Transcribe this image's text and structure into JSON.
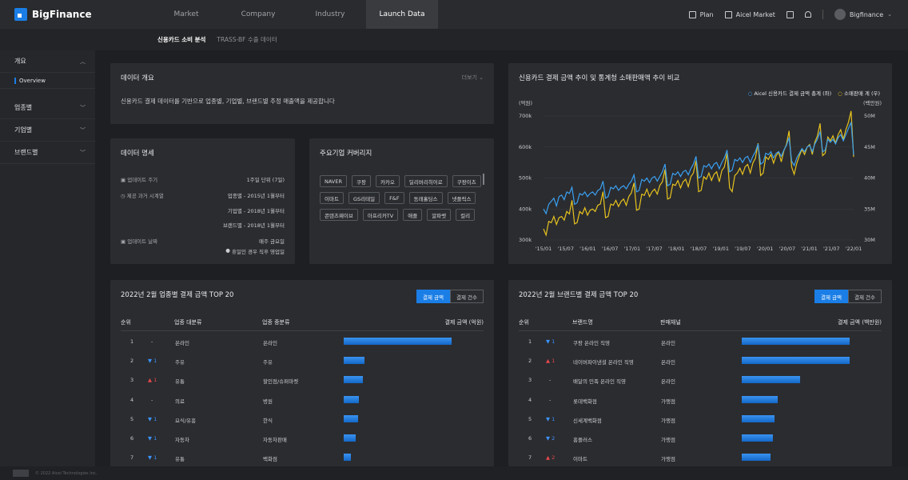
{
  "app": {
    "logo": "BigFinance"
  },
  "nav": {
    "tabs": [
      "Market",
      "Company",
      "Industry",
      "Launch Data"
    ],
    "right": {
      "plan": "Plan",
      "aicel_market": "Aicel Market",
      "user": "Bigfinance"
    }
  },
  "subnav": {
    "tabs": [
      "신용카드 소비 분석",
      "TRASS-BF 수출 데이터"
    ]
  },
  "sidebar": {
    "items": [
      {
        "label": "개요",
        "sub": "Overview"
      },
      {
        "label": "업종별"
      },
      {
        "label": "기업별"
      },
      {
        "label": "브랜드별"
      }
    ]
  },
  "overview": {
    "title": "데이터 개요",
    "more": "더보기",
    "text": "신용카드 결제 데이터를 기반으로 업종별, 기업별, 브랜드별 추정 매출액을 제공합니다"
  },
  "spec": {
    "title": "데이터 명세",
    "rows": [
      {
        "key": "업데이트 주기",
        "value": "1주일 단위 (7일)"
      },
      {
        "key": "제공 과거 시계열",
        "value": "업종별 - 2015년 1월부터"
      },
      {
        "key": "",
        "value": "기업별 - 2018년 1월부터"
      },
      {
        "key": "",
        "value": "브랜드별 - 2018년 1월부터"
      },
      {
        "key": "업데이트 날짜",
        "value": "매주 금요일"
      }
    ],
    "note": "휴일인 경우 직후 영업일"
  },
  "coverage": {
    "title": "주요기업 커버리지",
    "tags": [
      "NAVER",
      "쿠팡",
      "카카오",
      "딜리버리히어로",
      "쿠팡이츠",
      "이마트",
      "GS리테일",
      "F&F",
      "동래홀딩스",
      "넷플릭스",
      "콘텐츠웨이브",
      "아프리카TV",
      "애플",
      "알파벳",
      "컬리"
    ]
  },
  "trend": {
    "title": "신용카드 결제 금액 추이 및 통계청 소매판매액 추이 비교",
    "legend": [
      "Aicel 신용카드 결제 금액 총계 (좌)",
      "소매판매 계 (우)"
    ],
    "colors": {
      "card": "#3aa0f0",
      "retail": "#e6c21e"
    }
  },
  "chart_data": {
    "type": "line",
    "title": "신용카드 결제 금액 추이 및 통계청 소매판매액 추이 비교",
    "y_left_unit": "(억원)",
    "y_right_unit": "(백만원)",
    "y_left_ticks": [
      "700k",
      "600k",
      "500k",
      "400k",
      "300k"
    ],
    "y_right_ticks": [
      "50M",
      "45M",
      "40M",
      "35M",
      "30M"
    ],
    "x_ticks": [
      "'15/01",
      "'15/07",
      "'16/01",
      "'16/07",
      "'17/01",
      "'17/07",
      "'18/01",
      "'18/07",
      "'19/01",
      "'19/07",
      "'20/01",
      "'20/07",
      "'21/01",
      "'21/07",
      "'22/01"
    ],
    "ylim_left": [
      300000,
      700000
    ],
    "ylim_right": [
      30000000,
      50000000
    ],
    "series": [
      {
        "name": "Aicel 신용카드 결제 금액 총계 (좌)",
        "values": [
          400000,
          385000,
          415000,
          425000,
          435000,
          410000,
          440000,
          445000,
          430000,
          455000,
          450000,
          470000,
          415000,
          420000,
          450000,
          445000,
          455000,
          440000,
          450000,
          455000,
          445000,
          460000,
          465000,
          490000,
          435000,
          440000,
          470000,
          465000,
          475000,
          460000,
          470000,
          475000,
          465000,
          480000,
          490000,
          510000,
          455000,
          460000,
          495000,
          490000,
          500000,
          485000,
          500000,
          505000,
          490000,
          505000,
          520000,
          545000,
          475000,
          480000,
          515000,
          510000,
          520000,
          505000,
          520000,
          525000,
          510000,
          530000,
          545000,
          570000,
          500000,
          505000,
          540000,
          535000,
          545000,
          530000,
          545000,
          550000,
          530000,
          550000,
          565000,
          590000,
          520000,
          525000,
          560000,
          555000,
          565000,
          550000,
          565000,
          570000,
          550000,
          570000,
          585000,
          610000,
          545000,
          550000,
          580000,
          575000,
          585000,
          565000,
          580000,
          585000,
          570000,
          590000,
          605000,
          630000,
          555000,
          540000,
          565000,
          580000,
          595000,
          585000,
          600000,
          605000,
          585000,
          610000,
          625000,
          650000,
          585000,
          590000,
          625000,
          615000,
          625000,
          610000,
          630000,
          640000,
          620000,
          640000,
          660000,
          680000,
          575000
        ]
      },
      {
        "name": "소매판매 계 (우)",
        "values": [
          31800000,
          30800000,
          33000000,
          32800000,
          33800000,
          32500000,
          33600000,
          33800000,
          33200000,
          34600000,
          34200000,
          36400000,
          32600000,
          32800000,
          34600000,
          34200000,
          35200000,
          34000000,
          34800000,
          35000000,
          34600000,
          35600000,
          35800000,
          37800000,
          33600000,
          33800000,
          35800000,
          35600000,
          36400000,
          35400000,
          36200000,
          36600000,
          35600000,
          37000000,
          37600000,
          39200000,
          34800000,
          35000000,
          37400000,
          37200000,
          38200000,
          37000000,
          37800000,
          38200000,
          37400000,
          38800000,
          39400000,
          41400000,
          36600000,
          36800000,
          39000000,
          38800000,
          39600000,
          38400000,
          39400000,
          39800000,
          38600000,
          40200000,
          40800000,
          42800000,
          37800000,
          38000000,
          40200000,
          39800000,
          40800000,
          39600000,
          40600000,
          41000000,
          39400000,
          41200000,
          41800000,
          44000000,
          38400000,
          37800000,
          40400000,
          40800000,
          41600000,
          40600000,
          41800000,
          42200000,
          40800000,
          42400000,
          43200000,
          45600000,
          40400000,
          40800000,
          43400000,
          43000000,
          43800000,
          42400000,
          43600000,
          44200000,
          42600000,
          44400000,
          45400000,
          47600000,
          41800000,
          40600000,
          42400000,
          43600000,
          44600000,
          43800000,
          45000000,
          45400000,
          43800000,
          45800000,
          46800000,
          48800000,
          43600000,
          44000000,
          46600000,
          46000000,
          46800000,
          45600000,
          47000000,
          47800000,
          46200000,
          47800000,
          49000000,
          50800000,
          43400000
        ]
      }
    ]
  },
  "industry": {
    "title": "2022년 2월 업종별 결제 금액 TOP 20",
    "toggle": [
      "결제 금액",
      "결제 건수"
    ],
    "headers": [
      "순위",
      "업종 대분류",
      "업종 중분류",
      "결제 금액 (억원)"
    ],
    "rows": [
      {
        "rank": "1",
        "chg": "-",
        "dir": "",
        "major": "온라인",
        "minor": "온라인",
        "value": 1.0
      },
      {
        "rank": "2",
        "chg": "▼ 1",
        "dir": "dn",
        "major": "주유",
        "minor": "주유",
        "value": 0.19
      },
      {
        "rank": "3",
        "chg": "▲ 1",
        "dir": "up",
        "major": "유통",
        "minor": "할인점/슈퍼마켓",
        "value": 0.18
      },
      {
        "rank": "4",
        "chg": "-",
        "dir": "",
        "major": "의료",
        "minor": "병원",
        "value": 0.14
      },
      {
        "rank": "5",
        "chg": "▼ 1",
        "dir": "dn",
        "major": "요식/유흥",
        "minor": "한식",
        "value": 0.13
      },
      {
        "rank": "6",
        "chg": "▼ 1",
        "dir": "dn",
        "major": "자동차",
        "minor": "자동차판매",
        "value": 0.11
      },
      {
        "rank": "7",
        "chg": "▼ 1",
        "dir": "dn",
        "major": "유통",
        "minor": "백화점",
        "value": 0.07
      }
    ]
  },
  "brand": {
    "title": "2022년 2월 브랜드별 결제 금액 TOP 20",
    "toggle": [
      "결제 금액",
      "결제 건수"
    ],
    "headers": [
      "순위",
      "브랜드명",
      "판매채널",
      "결제 금액 (백만원)"
    ],
    "rows": [
      {
        "rank": "1",
        "chg": "▼ 1",
        "dir": "dn",
        "major": "쿠팡 온라인 직영",
        "minor": "온라인",
        "value": 1.0
      },
      {
        "rank": "2",
        "chg": "▲ 1",
        "dir": "up",
        "major": "네이버파이낸셜 온라인 직영",
        "minor": "온라인",
        "value": 1.0
      },
      {
        "rank": "3",
        "chg": "-",
        "dir": "",
        "major": "배달의 민족 온라인 직영",
        "minor": "온라인",
        "value": 0.54
      },
      {
        "rank": "4",
        "chg": "-",
        "dir": "",
        "major": "롯데백화점",
        "minor": "가맹점",
        "value": 0.33
      },
      {
        "rank": "5",
        "chg": "▼ 1",
        "dir": "dn",
        "major": "신세계백화점",
        "minor": "가맹점",
        "value": 0.3
      },
      {
        "rank": "6",
        "chg": "▼ 2",
        "dir": "dn",
        "major": "홈플러스",
        "minor": "가맹점",
        "value": 0.29
      },
      {
        "rank": "7",
        "chg": "▲ 2",
        "dir": "up",
        "major": "이마트",
        "minor": "가맹점",
        "value": 0.27
      }
    ]
  },
  "footer": {
    "text": "© 2022 Aicel Technologies Inc."
  }
}
